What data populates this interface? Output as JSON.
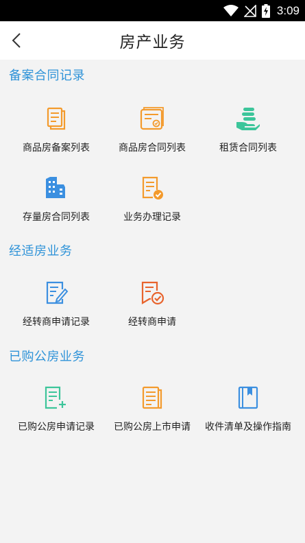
{
  "status_bar": {
    "time": "3:09"
  },
  "nav": {
    "title": "房产业务"
  },
  "sections": [
    {
      "title": "备案合同记录",
      "items": [
        {
          "label": "商品房备案列表",
          "icon": "document-list-icon"
        },
        {
          "label": "商品房合同列表",
          "icon": "contract-seal-icon"
        },
        {
          "label": "租赁合同列表",
          "icon": "hand-coins-icon"
        },
        {
          "label": "存量房合同列表",
          "icon": "building-icon"
        },
        {
          "label": "业务办理记录",
          "icon": "document-check-icon"
        }
      ]
    },
    {
      "title": "经适房业务",
      "items": [
        {
          "label": "经转商申请记录",
          "icon": "edit-document-icon"
        },
        {
          "label": "经转商申请",
          "icon": "approve-document-icon"
        }
      ]
    },
    {
      "title": "已购公房业务",
      "items": [
        {
          "label": "已购公房申请记录",
          "icon": "add-document-icon"
        },
        {
          "label": "已购公房上市申请",
          "icon": "document-lines-icon"
        },
        {
          "label": "收件清单及操作指南",
          "icon": "guide-book-icon"
        }
      ]
    }
  ],
  "colors": {
    "section_title": "#2f93d8",
    "orange": "#f39a2c",
    "blue": "#3b8fe0",
    "green": "#3cc59a",
    "background": "#f3f3f3"
  }
}
